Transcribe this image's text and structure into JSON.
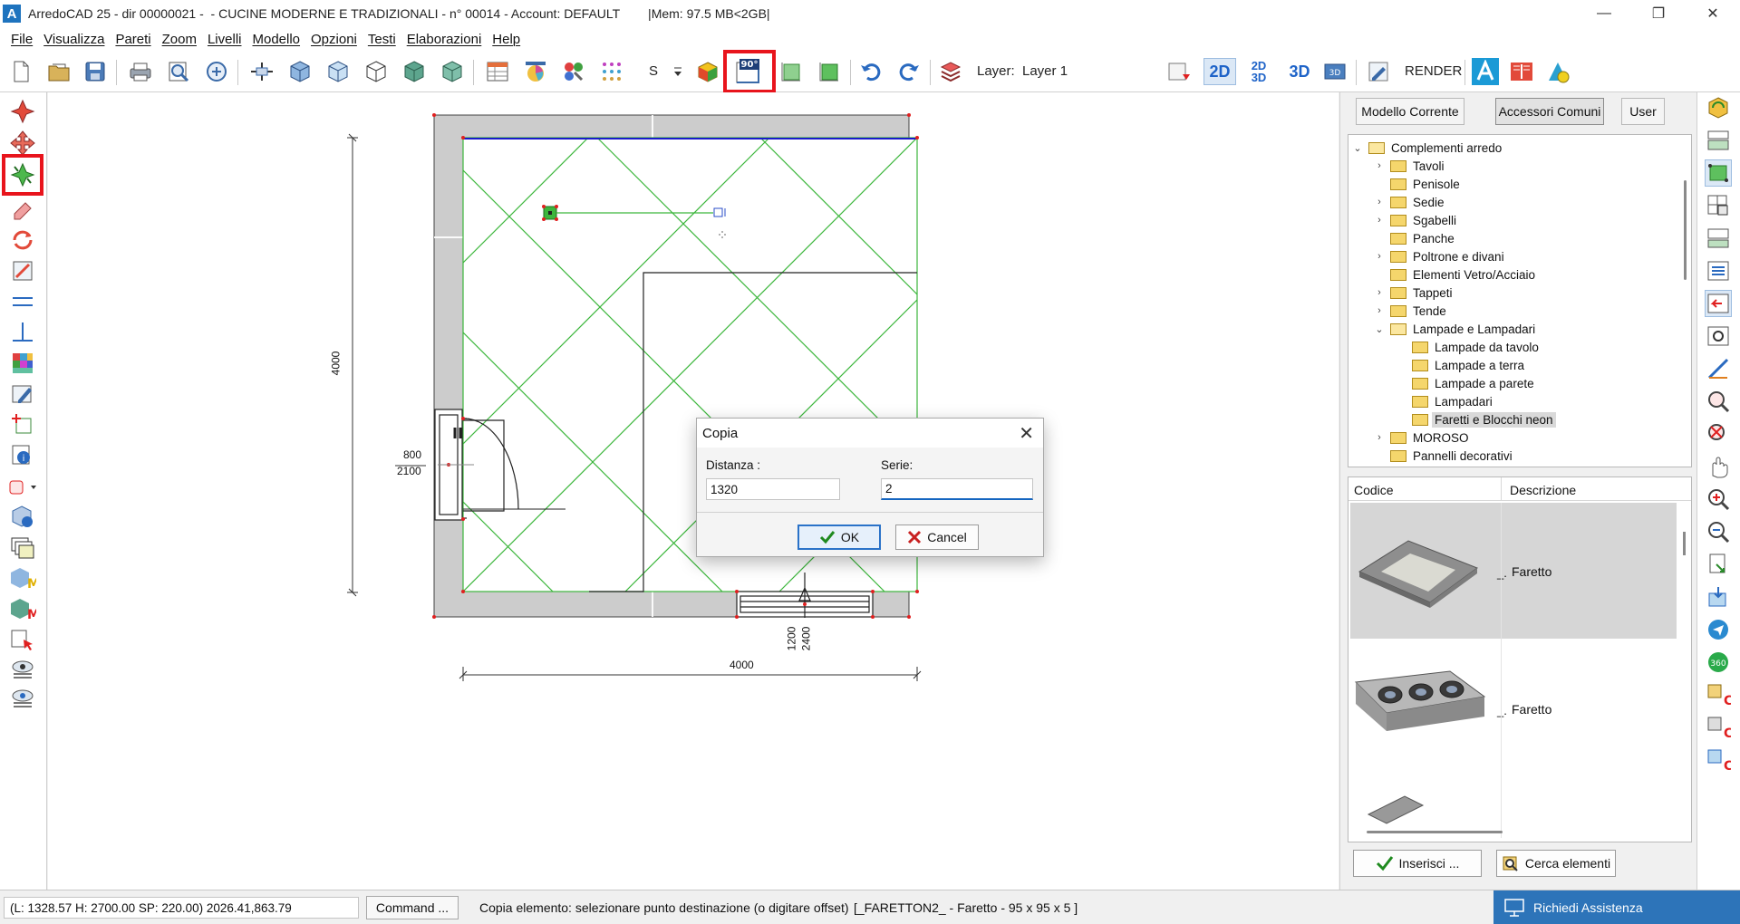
{
  "window": {
    "app_icon_letter": "A",
    "title": "ArredoCAD 25 - dir 00000021 -  - CUCINE MODERNE E TRADIZIONALI - n° 00014 - Account: DEFAULT        |Mem: 97.5 MB<2GB|",
    "minimize": "—",
    "maximize": "❐",
    "close": "✕"
  },
  "menu": [
    "File",
    "Visualizza",
    "Pareti",
    "Zoom",
    "Livelli",
    "Modello",
    "Opzioni",
    "Testi",
    "Elaborazioni",
    "Help"
  ],
  "toolbar": {
    "s_label": "S",
    "rotate_90_label": "90°",
    "layer_label": "Layer:",
    "layer_value": "Layer 1",
    "view_2d": "2D",
    "view_2d3d_top": "2D",
    "view_2d3d_bottom": "3D",
    "view_3d": "3D",
    "render_label": "RENDER"
  },
  "drawing": {
    "dim_top_vertical": "4000",
    "dim_door_width": "800",
    "dim_door_height": "2100",
    "dim_window_width": "1200",
    "dim_window_height": "2400",
    "dim_bottom": "4000"
  },
  "dialog": {
    "title": "Copia",
    "distance_label": "Distanza :",
    "distance_value": "1320",
    "series_label": "Serie:",
    "series_value": "2",
    "ok_label": "OK",
    "cancel_label": "Cancel"
  },
  "right_panel": {
    "tabs": [
      "Modello Corrente",
      "Accessori Comuni",
      "User"
    ],
    "active_tab": "Accessori Comuni",
    "tree": [
      {
        "label": "Complementi arredo",
        "level": 0,
        "expander": "v",
        "open": true
      },
      {
        "label": "Tavoli",
        "level": 1,
        "expander": ">"
      },
      {
        "label": "Penisole",
        "level": 1,
        "expander": ""
      },
      {
        "label": "Sedie",
        "level": 1,
        "expander": ">"
      },
      {
        "label": "Sgabelli",
        "level": 1,
        "expander": ">"
      },
      {
        "label": "Panche",
        "level": 1,
        "expander": ""
      },
      {
        "label": "Poltrone e divani",
        "level": 1,
        "expander": ">"
      },
      {
        "label": "Elementi Vetro/Acciaio",
        "level": 1,
        "expander": ""
      },
      {
        "label": "Tappeti",
        "level": 1,
        "expander": ">"
      },
      {
        "label": "Tende",
        "level": 1,
        "expander": ">"
      },
      {
        "label": "Lampade e Lampadari",
        "level": 1,
        "expander": "v",
        "open": true
      },
      {
        "label": "Lampade da tavolo",
        "level": 2,
        "expander": ""
      },
      {
        "label": "Lampade a terra",
        "level": 2,
        "expander": ""
      },
      {
        "label": "Lampade a parete",
        "level": 2,
        "expander": ""
      },
      {
        "label": "Lampadari",
        "level": 2,
        "expander": ""
      },
      {
        "label": "Faretti e Blocchi neon",
        "level": 2,
        "expander": "",
        "selected": true
      },
      {
        "label": "MOROSO",
        "level": 1,
        "expander": ">"
      },
      {
        "label": "Pannelli decorativi",
        "level": 1,
        "expander": ""
      }
    ],
    "list_headers": {
      "code": "Codice",
      "description": "Descrizione"
    },
    "items": [
      {
        "code": "_.",
        "description": "Faretto"
      },
      {
        "code": "_.",
        "description": "Faretto"
      }
    ],
    "insert_button": "Inserisci ...",
    "search_button": "Cerca elementi"
  },
  "status": {
    "coords": "(L: 1328.57 H: 2700.00 SP: 220.00)  2026.41,863.79",
    "command_button": "Command ...",
    "message": "Copia elemento: selezionare punto destinazione (o digitare offset)",
    "element": "[_FARETTON2_ - Faretto - 95 x 95 x 5 ]",
    "assist_button": "Richiedi Assistenza"
  },
  "colors": {
    "highlight": "#e8141c",
    "wall_gray": "#c8c8c8",
    "grid_green": "#3cb63c",
    "blue_line": "#1a1acc",
    "accent_blue": "#2d74b9"
  }
}
